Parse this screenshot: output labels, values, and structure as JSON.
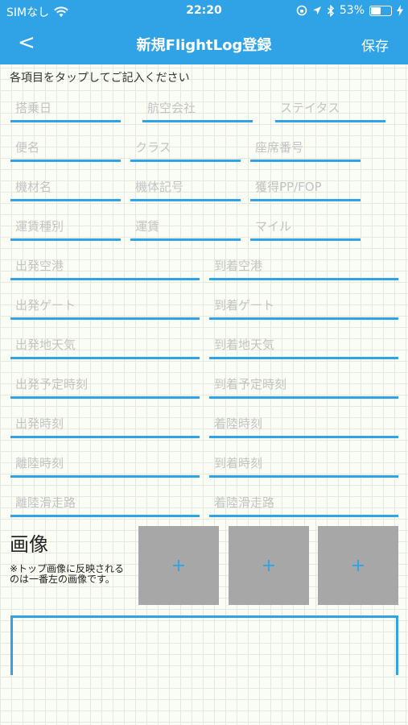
{
  "status_bar": {
    "carrier": "SIMなし",
    "time": "22:20",
    "battery": "53%",
    "battery_level": 0.53
  },
  "nav": {
    "back": "<",
    "title": "新規FlightLog登録",
    "save": "保存"
  },
  "instruction": "各項目をタップしてご記入ください",
  "fields": {
    "boarding_date": "搭乗日",
    "airline": "航空会社",
    "status": "ステイタス",
    "flight_number": "便名",
    "class": "クラス",
    "seat": "座席番号",
    "aircraft": "機材名",
    "registration": "機体記号",
    "pp_fop": "獲得PP/FOP",
    "fare_type": "運賃種別",
    "fare": "運賃",
    "miles": "マイル",
    "departure_airport": "出発空港",
    "arrival_airport": "到着空港",
    "departure_gate": "出発ゲート",
    "arrival_gate": "到着ゲート",
    "departure_weather": "出発地天気",
    "arrival_weather": "到着地天気",
    "scheduled_departure": "出発予定時刻",
    "scheduled_arrival": "到着予定時刻",
    "departure_time": "出発時刻",
    "landing_time": "着陸時刻",
    "takeoff_time": "離陸時刻",
    "arrival_time": "到着時刻",
    "takeoff_runway": "離陸滑走路",
    "landing_runway": "着陸滑走路"
  },
  "images": {
    "title": "画像",
    "note": "※トップ画像に反映されるのは一番左の画像です。",
    "add_label": "+"
  },
  "memo": {
    "value": ""
  }
}
